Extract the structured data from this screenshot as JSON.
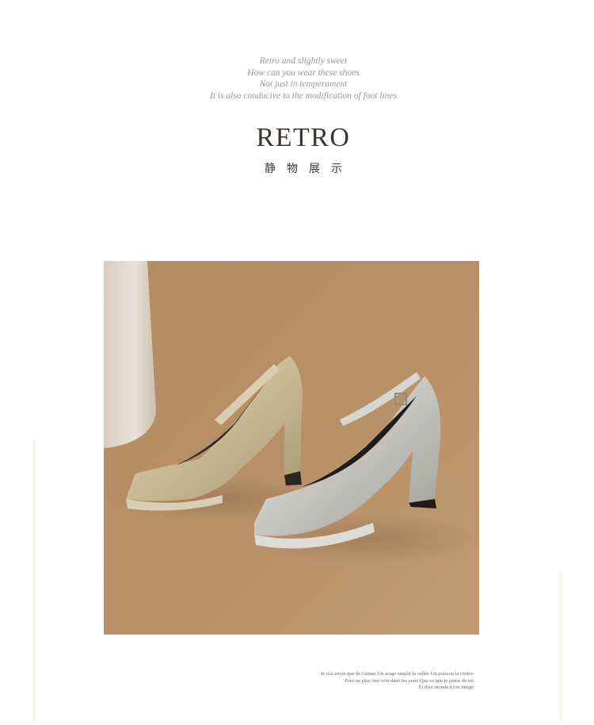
{
  "intro": {
    "lines": [
      "Retro and slightly sweet",
      "How can you wear these shoes",
      "Not just in temperament",
      "It is also conducive to the modification of foot lines"
    ]
  },
  "title": "RETRO",
  "subtitle": "静物展示",
  "photo": {
    "background_color": "#b48e67",
    "shoe_colors": [
      "#c9bd9a",
      "#bdbcb6"
    ]
  },
  "caption": {
    "lines": [
      "Je n'ai envie que de t'aimer Un orage emplit la vallée Un poisson la rivière",
      "Pour ne plus rien voir dans tes yeux Que ce que je pense de toi",
      "Et d'un monde à ton image"
    ]
  }
}
